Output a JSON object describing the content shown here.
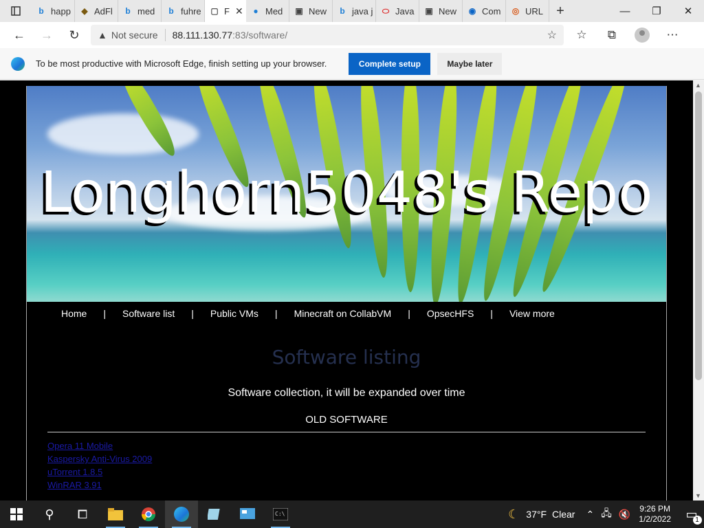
{
  "browser": {
    "tabs": [
      {
        "label": "happ",
        "icon": "bing-icon"
      },
      {
        "label": "AdFl",
        "icon": "adfly-icon"
      },
      {
        "label": "med",
        "icon": "bing-icon"
      },
      {
        "label": "fuhre",
        "icon": "bing-icon"
      },
      {
        "label": "F",
        "icon": "page-icon",
        "active": true
      },
      {
        "label": "Med",
        "icon": "medium-icon"
      },
      {
        "label": "New",
        "icon": "newtab-icon"
      },
      {
        "label": "java j",
        "icon": "bing-icon"
      },
      {
        "label": "Java",
        "icon": "oracle-icon"
      },
      {
        "label": "New",
        "icon": "newtab-icon"
      },
      {
        "label": "Com",
        "icon": "shield-icon"
      },
      {
        "label": "URL",
        "icon": "url-icon"
      }
    ],
    "address": {
      "security_label": "Not secure",
      "url_host": "88.111.130.77",
      "url_rest": ":83/software/"
    },
    "infobar": {
      "message": "To be most productive with Microsoft Edge, finish setting up your browser.",
      "primary_button": "Complete setup",
      "secondary_button": "Maybe later"
    }
  },
  "page": {
    "banner_title": "Longhorn5048's Repo",
    "nav": [
      "Home",
      "Software list",
      "Public VMs",
      "Minecraft on CollabVM",
      "OpsecHFS",
      "View more"
    ],
    "nav_separator": "|",
    "listing_title": "Software listing",
    "listing_subtitle": "Software collection, it will be expanded over time",
    "section_heading": "OLD SOFTWARE",
    "software": [
      "Opera 11 Mobile",
      "Kaspersky Anti-Virus 2009",
      "uTorrent 1.8.5",
      "WinRAR 3.91"
    ]
  },
  "taskbar": {
    "weather_temp": "37°F",
    "weather_desc": "Clear",
    "time": "9:26 PM",
    "date": "1/2/2022",
    "notification_count": "1"
  },
  "colors": {
    "accent": "#0a64c6",
    "page_bg": "#000000",
    "listing_title": "#25304f",
    "link": "#1a1aa6"
  }
}
